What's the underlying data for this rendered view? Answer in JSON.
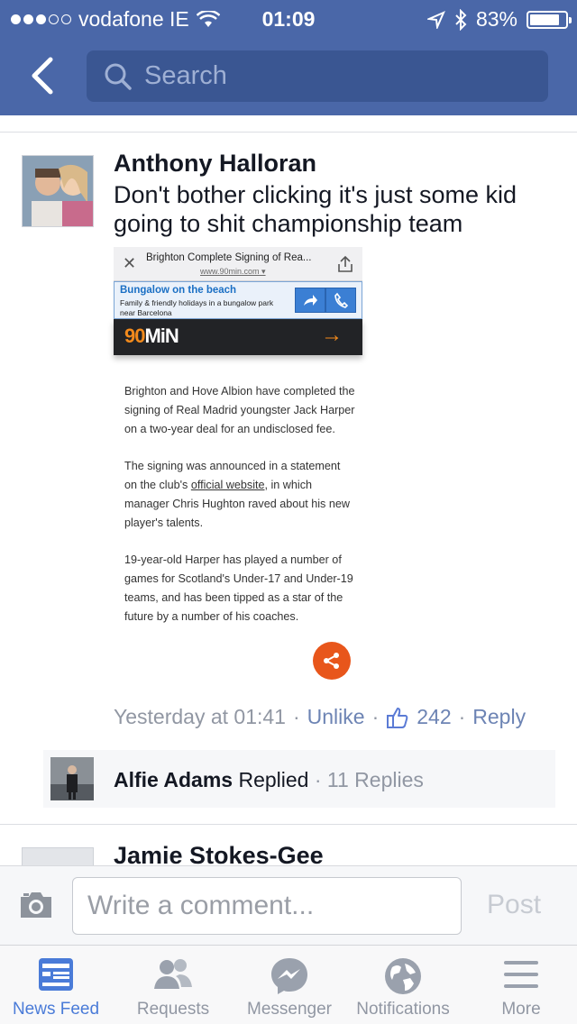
{
  "status_bar": {
    "carrier": "vodafone IE",
    "time": "01:09",
    "battery": "83%",
    "battery_level": 0.83
  },
  "nav": {
    "search_placeholder": "Search"
  },
  "post": {
    "author": "Anthony Halloran",
    "text": "Don't bother clicking it's just some kid going to shit championship team",
    "attachment": {
      "page_title": "Brighton Complete Signing of Rea...",
      "url": "www.90min.com",
      "ad_title": "Bungalow on the beach",
      "ad_desc": "Family & friendly holidays in a bungalow park near Barcelona",
      "logo_a": "90",
      "logo_b": "MiN",
      "para1": "Brighton and Hove Albion have completed the signing of Real Madrid youngster Jack Harper on a two-year deal for an undisclosed fee.",
      "para2_a": "The signing was announced in a statement on the club's ",
      "para2_link": "official website",
      "para2_b": ", in which manager Chris Hughton raved about his new player's talents.",
      "para3": "19-year-old Harper has played a number of games for Scotland's Under-17 and Under-19 teams, and has been tipped as a star of the future by a number of his coaches."
    },
    "timestamp": "Yesterday at 01:41",
    "sep": "·",
    "unlike": "Unlike",
    "like_count": "242",
    "reply": "Reply"
  },
  "reply_summary": {
    "name": "Alfie Adams",
    "verb": "Replied",
    "count": "· 11 Replies"
  },
  "next_comment": {
    "author": "Jamie Stokes-Gee"
  },
  "composer": {
    "placeholder": "Write a comment...",
    "post_label": "Post"
  },
  "tabs": [
    {
      "label": "News Feed",
      "icon": "news-feed-icon"
    },
    {
      "label": "Requests",
      "icon": "friends-icon"
    },
    {
      "label": "Messenger",
      "icon": "messenger-icon"
    },
    {
      "label": "Notifications",
      "icon": "globe-icon"
    },
    {
      "label": "More",
      "icon": "menu-icon"
    }
  ],
  "colors": {
    "header": "#4a67a8",
    "link": "#6d84b4",
    "active_tab": "#4a7bd8",
    "share_fab": "#e8561b",
    "brand_orange": "#f28a1c"
  }
}
